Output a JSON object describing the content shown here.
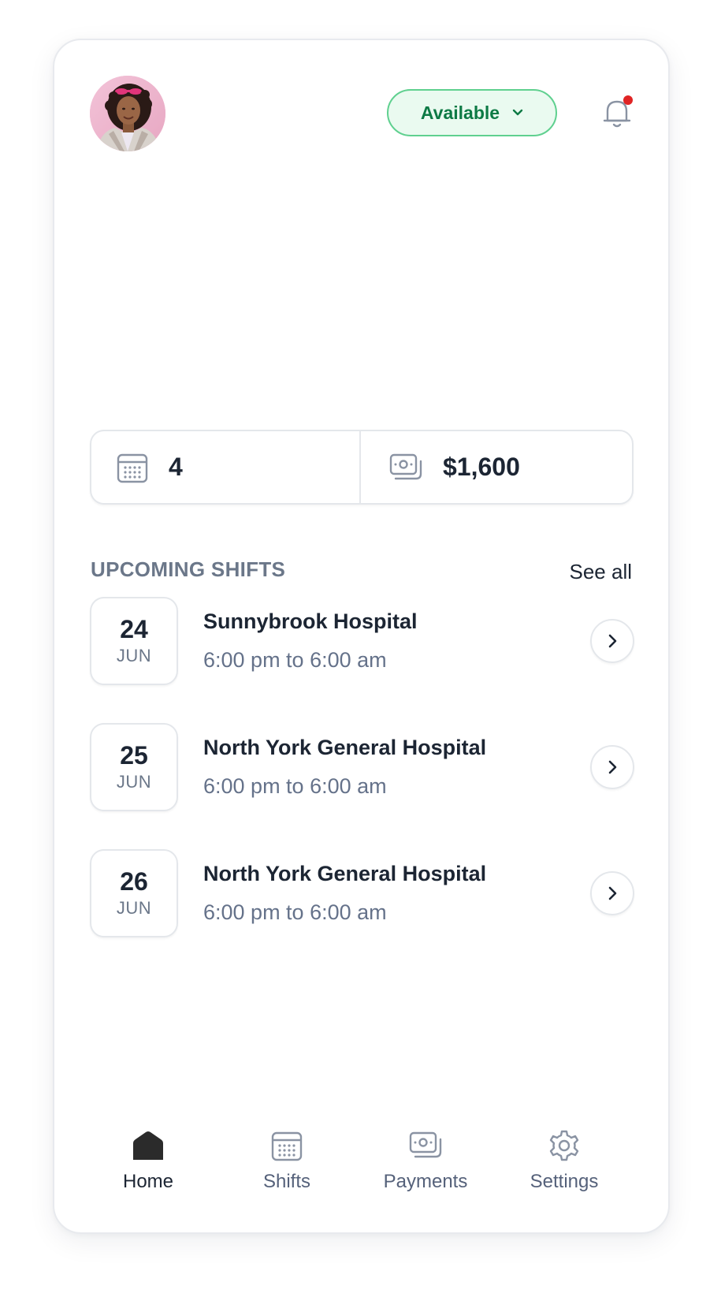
{
  "header": {
    "avatar_alt": "profile-avatar",
    "status_label": "Available",
    "notification_badge": true
  },
  "stats": {
    "shifts_count": "4",
    "earnings": "$1,600",
    "shifts_icon": "calendar-icon",
    "earnings_icon": "cash-icon"
  },
  "upcoming": {
    "title": "UPCOMING SHIFTS",
    "see_all_label": "See all",
    "shifts": [
      {
        "day": "24",
        "month": "JUN",
        "hospital": "Sunnybrook Hospital",
        "time": "6:00 pm to 6:00 am"
      },
      {
        "day": "25",
        "month": "JUN",
        "hospital": "North York General Hospital",
        "time": "6:00 pm to 6:00 am"
      },
      {
        "day": "26",
        "month": "JUN",
        "hospital": "North York General Hospital",
        "time": "6:00 pm to 6:00 am"
      }
    ]
  },
  "nav": {
    "items": [
      {
        "label": "Home",
        "icon": "home-icon",
        "active": true
      },
      {
        "label": "Shifts",
        "icon": "calendar-icon",
        "active": false
      },
      {
        "label": "Payments",
        "icon": "cash-icon",
        "active": false
      },
      {
        "label": "Settings",
        "icon": "gear-icon",
        "active": false
      }
    ]
  },
  "colors": {
    "status_green": "#0d7a45",
    "status_bg": "#eafaf0",
    "notification_dot": "#e02424",
    "text_primary": "#1c2533",
    "text_muted": "#6b7789"
  }
}
